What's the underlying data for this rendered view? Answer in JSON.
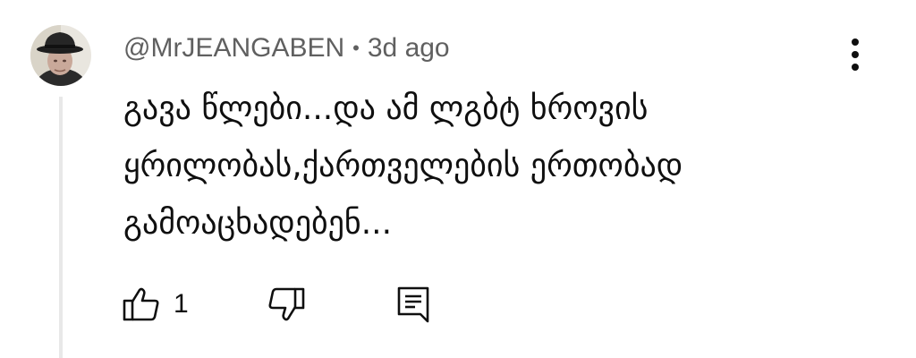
{
  "comment": {
    "author": "@MrJEANGABEN",
    "separator": "•",
    "time": "3d ago",
    "text": "გავა წლები...და ამ ლგბტ ხროვის\nყრილობას,ქართველების ერთობად\nგამოაცხადებენ...",
    "like_count": "1"
  },
  "icons": {
    "menu": "more-vert-icon",
    "like": "thumb-up-icon",
    "dislike": "thumb-down-icon",
    "reply": "reply-comment-icon"
  },
  "colors": {
    "text_primary": "#0f0f0f",
    "text_secondary": "#606060",
    "icon": "#0f0f0f",
    "thread_line": "#e8e8e8"
  }
}
